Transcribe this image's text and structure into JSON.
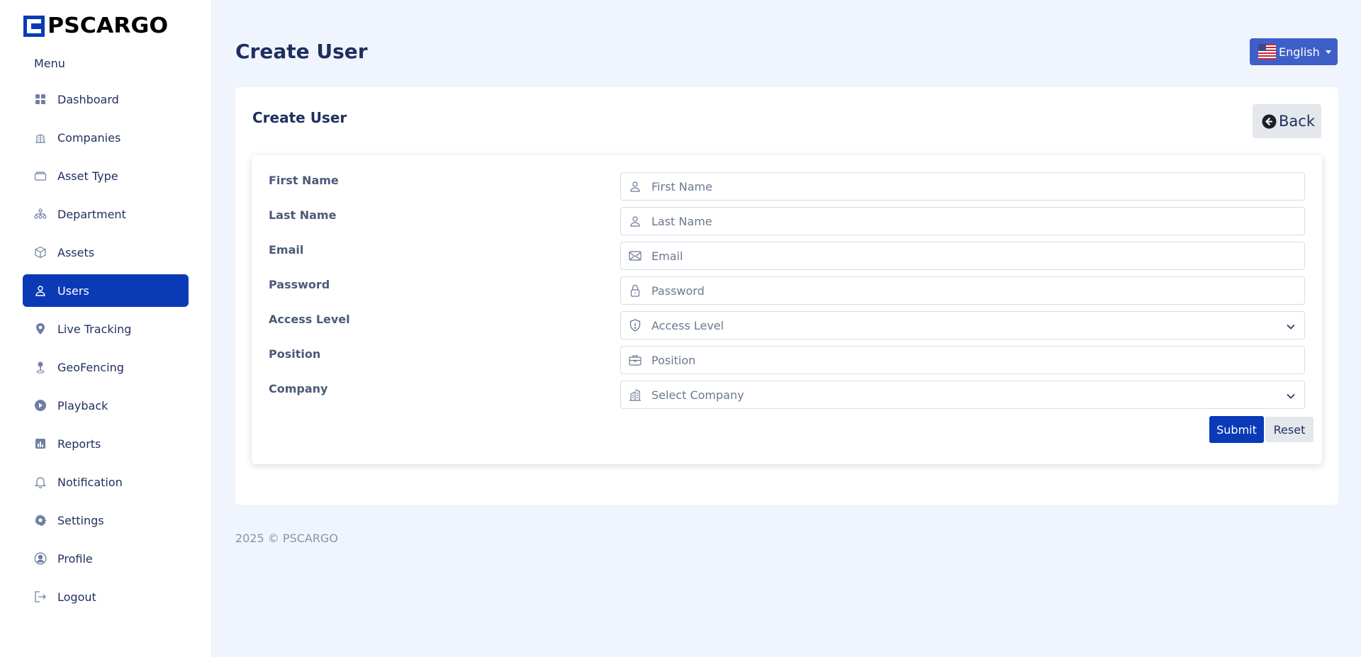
{
  "brand": {
    "name": "PSCARGO"
  },
  "sidebar": {
    "menu_title": "Menu",
    "items": [
      {
        "label": "Dashboard",
        "icon": "dashboard-icon"
      },
      {
        "label": "Companies",
        "icon": "building-icon"
      },
      {
        "label": "Asset Type",
        "icon": "box-icon"
      },
      {
        "label": "Department",
        "icon": "hierarchy-icon"
      },
      {
        "label": "Assets",
        "icon": "cube-icon"
      },
      {
        "label": "Users",
        "icon": "user-icon",
        "active": true
      },
      {
        "label": "Live Tracking",
        "icon": "map-pin-icon"
      },
      {
        "label": "GeoFencing",
        "icon": "geofence-icon"
      },
      {
        "label": "Playback",
        "icon": "play-icon"
      },
      {
        "label": "Reports",
        "icon": "report-icon"
      },
      {
        "label": "Notification",
        "icon": "bell-icon"
      },
      {
        "label": "Settings",
        "icon": "gear-icon"
      },
      {
        "label": "Profile",
        "icon": "profile-icon"
      },
      {
        "label": "Logout",
        "icon": "logout-icon"
      }
    ]
  },
  "header": {
    "title": "Create User",
    "language": {
      "label": "English",
      "icon": "us-flag-icon"
    }
  },
  "card": {
    "title": "Create User",
    "back_label": "Back"
  },
  "form": {
    "fields": [
      {
        "label": "First Name",
        "placeholder": "First Name",
        "icon": "user-icon",
        "type": "text"
      },
      {
        "label": "Last Name",
        "placeholder": "Last Name",
        "icon": "user-icon",
        "type": "text"
      },
      {
        "label": "Email",
        "placeholder": "Email",
        "icon": "envelope-icon",
        "type": "text"
      },
      {
        "label": "Password",
        "placeholder": "Password",
        "icon": "lock-icon",
        "type": "text"
      },
      {
        "label": "Access Level",
        "placeholder": "Access Level",
        "icon": "shield-icon",
        "type": "select"
      },
      {
        "label": "Position",
        "placeholder": "Position",
        "icon": "briefcase-icon",
        "type": "text"
      },
      {
        "label": "Company",
        "placeholder": "Select Company",
        "icon": "building-icon",
        "type": "select"
      }
    ],
    "submit_label": "Submit",
    "reset_label": "Reset"
  },
  "footer": {
    "text": "2025 © PSCARGO"
  },
  "colors": {
    "primary": "#0a3ab6",
    "language_button": "#3f5fc8",
    "background": "#f0f4fc",
    "text": "#1e2f5e"
  }
}
